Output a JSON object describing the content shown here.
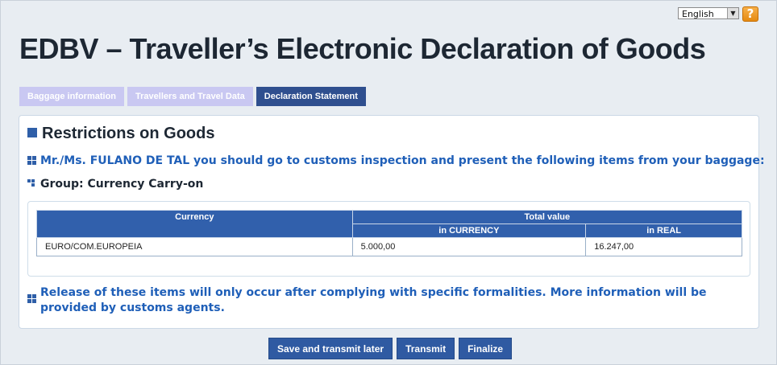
{
  "header": {
    "language": {
      "selected": "English"
    },
    "help_icon": "question-mark-icon",
    "title": "EDBV – Traveller’s Electronic Declaration of Goods"
  },
  "tabs": [
    {
      "label": "Baggage information",
      "active": false
    },
    {
      "label": "Travellers and Travel Data",
      "active": false
    },
    {
      "label": "Declaration Statement",
      "active": true
    }
  ],
  "section": {
    "title": "Restrictions on Goods",
    "inspection_message": "Mr./Ms. FULANO DE TAL you should go to customs inspection and present the following items from your baggage:",
    "group_label": "Group: Currency Carry-on",
    "table": {
      "headers": {
        "currency": "Currency",
        "total_value": "Total value",
        "in_currency": "in CURRENCY",
        "in_real": "in REAL"
      },
      "rows": [
        {
          "currency": "EURO/COM.EUROPEIA",
          "in_currency": "5.000,00",
          "in_real": "16.247,00"
        }
      ]
    },
    "release_message": "Release of these items will only occur after complying with specific formalities. More information will be provided by customs agents."
  },
  "actions": {
    "save_later": "Save and transmit later",
    "transmit": "Transmit",
    "finalize": "Finalize"
  },
  "colors": {
    "primary": "#2f5aa2",
    "inactive_tab": "#c9c8f2",
    "link_text": "#1f5fb8",
    "help_orange": "#f0a030"
  }
}
